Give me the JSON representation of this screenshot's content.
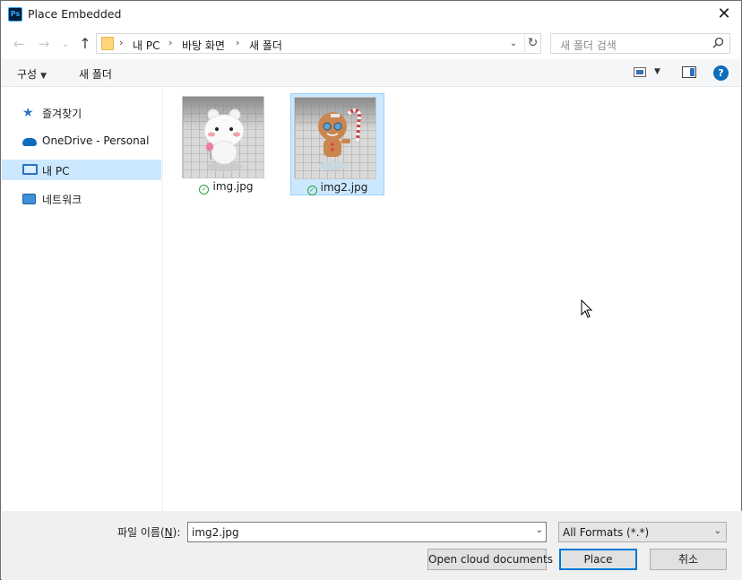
{
  "window": {
    "title": "Place Embedded",
    "app_icon": "Ps",
    "close": "✕"
  },
  "nav": {
    "back": "←",
    "forward": "→",
    "recent": "⌄",
    "up": "↑",
    "breadcrumb": [
      "내 PC",
      "바탕 화면",
      "새 폴더"
    ],
    "sep": "›",
    "refresh": "↻",
    "dropdown": "⌄",
    "search_placeholder": "새 폴더 검색"
  },
  "toolbar": {
    "organize": "구성",
    "new_folder": "새 폴더",
    "help": "?"
  },
  "sidebar": {
    "items": [
      {
        "label": "즐겨찾기",
        "icon": "star-icon"
      },
      {
        "label": "OneDrive - Personal",
        "icon": "cloud-icon"
      },
      {
        "label": "내 PC",
        "icon": "pc-icon"
      },
      {
        "label": "네트워크",
        "icon": "network-icon"
      }
    ],
    "selected_index": 2
  },
  "files": [
    {
      "name": "img.jpg",
      "status": "synced",
      "selected": false
    },
    {
      "name": "img2.jpg",
      "status": "synced",
      "selected": true
    }
  ],
  "bottom": {
    "filename_label": "파일 이름(",
    "filename_hotkey": "N",
    "filename_label_end": "):",
    "filename_value": "img2.jpg",
    "filter_value": "All Formats (*.*)",
    "btn_cloud": "Open cloud documents",
    "btn_place": "Place",
    "btn_cancel": "취소"
  },
  "colors": {
    "accent": "#0078d7",
    "selection": "#cce8ff",
    "sync": "#2e9e44"
  }
}
